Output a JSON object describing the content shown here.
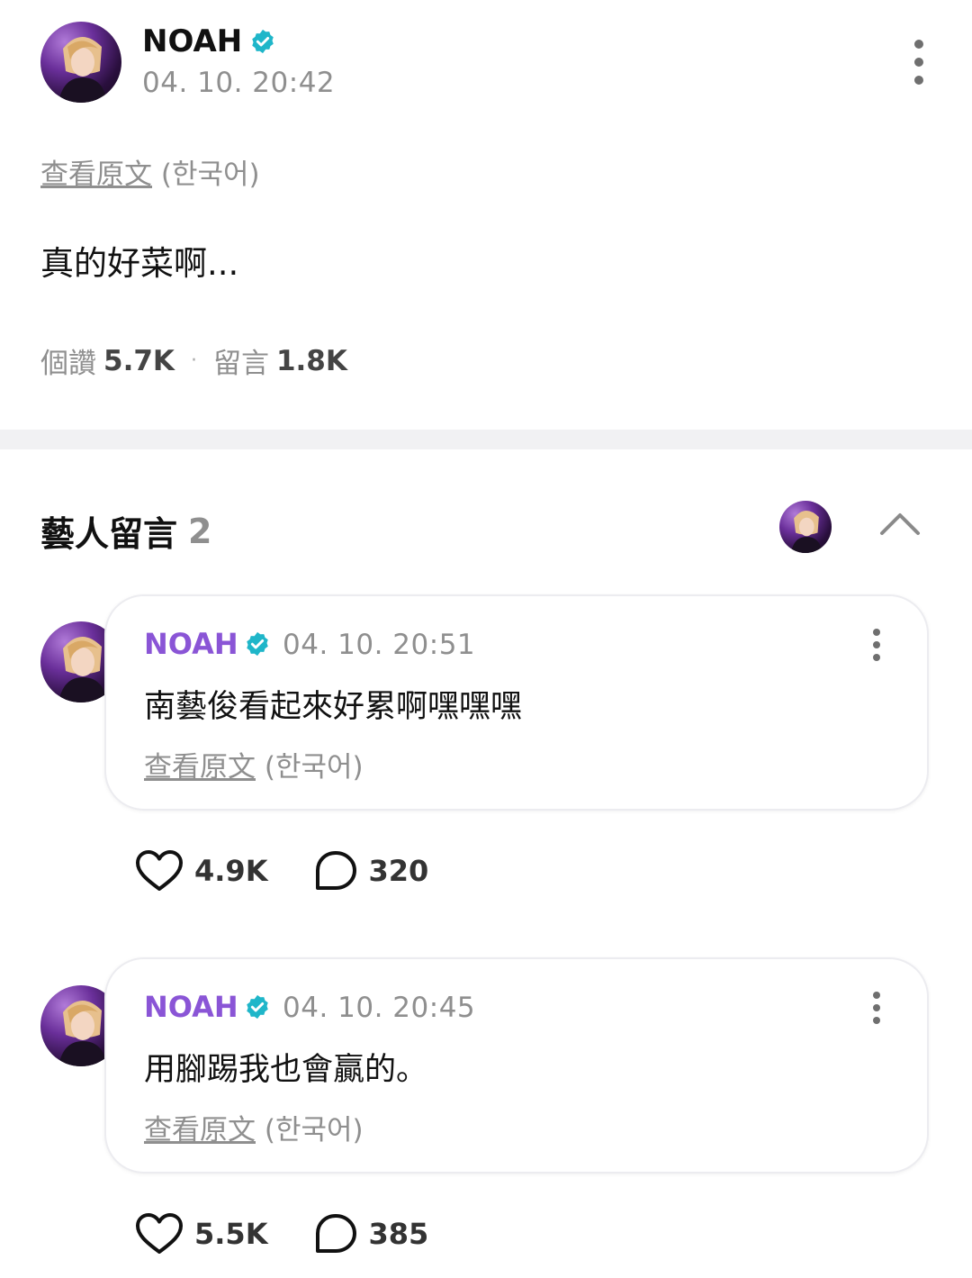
{
  "post": {
    "author": "NOAH",
    "timestamp": "04. 10. 20:42",
    "translate_link": "查看原文",
    "translate_lang": "(한국어)",
    "body": "真的好菜啊...",
    "likes_label": "個讚",
    "likes_count": "5.7K",
    "separator": "·",
    "comments_label": "留言",
    "comments_count": "1.8K"
  },
  "artist_comments": {
    "title": "藝人留言",
    "count": "2"
  },
  "comments": [
    {
      "author": "NOAH",
      "timestamp": "04. 10. 20:51",
      "text": "南藝俊看起來好累啊嘿嘿嘿",
      "translate_link": "查看原文",
      "translate_lang": "(한국어)",
      "likes": "4.9K",
      "replies": "320"
    },
    {
      "author": "NOAH",
      "timestamp": "04. 10. 20:45",
      "text": "用腳踢我也會贏的。",
      "translate_link": "查看原文",
      "translate_lang": "(한국어)",
      "likes": "5.5K",
      "replies": "385"
    }
  ],
  "icons": [
    "verified-badge-icon",
    "more-vertical-icon",
    "chevron-up-icon",
    "heart-icon",
    "comment-bubble-icon"
  ],
  "colors": {
    "accent_name": "#8a55d6",
    "verified": "#1fb6c9",
    "muted_text": "#8f8f8f",
    "divider": "#f1f1f3"
  }
}
